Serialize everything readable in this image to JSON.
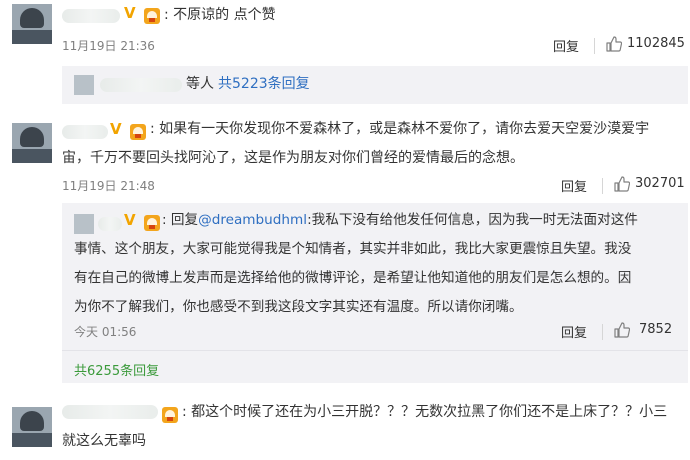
{
  "comments": [
    {
      "text": ": 不原谅的 点个赞",
      "time": "11月19日 21:36",
      "reply": "回复",
      "likes": "1102845",
      "thread_preview": {
        "prefix": "等人",
        "link": "共5223条回复"
      }
    },
    {
      "text_line1": ": 如果有一天你发现你不爱森林了，或是森林不爱你了，请你去爱天空爱沙漠爱宇",
      "text_line2": "宙，千万不要回头找阿沁了，这是作为朋友对你们曾经的爱情最后的念想。",
      "time": "11月19日 21:48",
      "reply": "回复",
      "likes": "302701",
      "sub_reply": {
        "prefix": ": 回复",
        "mention": "@dreambudhml",
        "line1_rest": ":我私下没有给他发任何信息，因为我一时无法面对这件",
        "line2": "事情、这个朋友，大家可能觉得我是个知情者，其实并非如此，我比大家更震惊且失望。我没",
        "line3": "有在自己的微博上发声而是选择给他的微博评论，是希望让他知道他的朋友们是怎么想的。因",
        "line4": "为你不了解我们，你也感受不到我这段文字其实还有温度。所以请你闭嘴。",
        "time": "今天 01:56",
        "reply": "回复",
        "likes": "7852"
      },
      "more_link": "共6255条回复"
    },
    {
      "text_line1": ": 都这个时候了还在为小三开脱？？？无数次拉黑了你们还不是上床了？？小三",
      "text_line2": "就这么无辜吗"
    }
  ],
  "colors": {
    "link_blue": "#2f6fc1",
    "link_green": "#3b9a3b",
    "vip_gold": "#f2a400",
    "reply_bg": "#f2f2f5"
  },
  "icons": [
    "vip-v-icon",
    "club-badge-icon",
    "thumbs-up-icon"
  ]
}
